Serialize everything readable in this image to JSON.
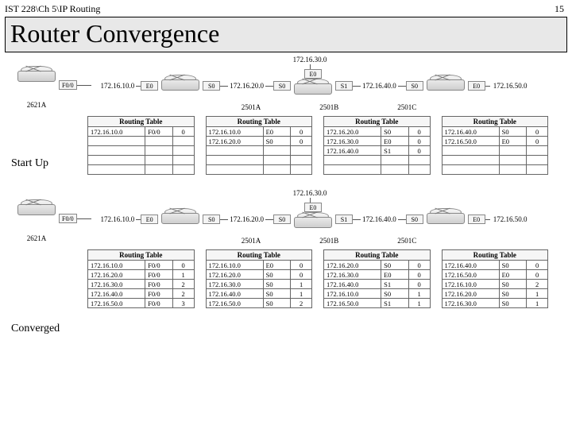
{
  "header": {
    "course": "IST 228\\Ch 5\\IP Routing",
    "page": "15"
  },
  "title": "Router Convergence",
  "labels": {
    "startup": "Start Up",
    "converged": "Converged",
    "rt_title": "Routing Table"
  },
  "nets": {
    "n10": "172.16.10.0",
    "n20": "172.16.20.0",
    "n30": "172.16.30.0",
    "n40": "172.16.40.0",
    "n50": "172.16.50.0"
  },
  "ports": {
    "f00": "F0/0",
    "e0": "E0",
    "s0": "S0",
    "s1": "S1"
  },
  "routers": {
    "a": "2621A",
    "b": "2501A",
    "c": "2501B",
    "d": "2501C"
  },
  "startup": {
    "r2621A": [
      [
        "172.16.10.0",
        "F0/0",
        "0"
      ]
    ],
    "r2501A": [
      [
        "172.16.10.0",
        "E0",
        "0"
      ],
      [
        "172.16.20.0",
        "S0",
        "0"
      ]
    ],
    "r2501B": [
      [
        "172.16.20.0",
        "S0",
        "0"
      ],
      [
        "172.16.30.0",
        "E0",
        "0"
      ],
      [
        "172.16.40.0",
        "S1",
        "0"
      ]
    ],
    "r2501C": [
      [
        "172.16.40.0",
        "S0",
        "0"
      ],
      [
        "172.16.50.0",
        "E0",
        "0"
      ]
    ]
  },
  "converged": {
    "r2621A": [
      [
        "172.16.10.0",
        "F0/0",
        "0"
      ],
      [
        "172.16.20.0",
        "F0/0",
        "1"
      ],
      [
        "172.16.30.0",
        "F0/0",
        "2"
      ],
      [
        "172.16.40.0",
        "F0/0",
        "2"
      ],
      [
        "172.16.50.0",
        "F0/0",
        "3"
      ]
    ],
    "r2501A": [
      [
        "172.16.10.0",
        "E0",
        "0"
      ],
      [
        "172.16.20.0",
        "S0",
        "0"
      ],
      [
        "172.16.30.0",
        "S0",
        "1"
      ],
      [
        "172.16.40.0",
        "S0",
        "1"
      ],
      [
        "172.16.50.0",
        "S0",
        "2"
      ]
    ],
    "r2501B": [
      [
        "172.16.20.0",
        "S0",
        "0"
      ],
      [
        "172.16.30.0",
        "E0",
        "0"
      ],
      [
        "172.16.40.0",
        "S1",
        "0"
      ],
      [
        "172.16.10.0",
        "S0",
        "1"
      ],
      [
        "172.16.50.0",
        "S1",
        "1"
      ]
    ],
    "r2501C": [
      [
        "172.16.40.0",
        "S0",
        "0"
      ],
      [
        "172.16.50.0",
        "E0",
        "0"
      ],
      [
        "172.16.10.0",
        "S0",
        "2"
      ],
      [
        "172.16.20.0",
        "S0",
        "1"
      ],
      [
        "172.16.30.0",
        "S0",
        "1"
      ]
    ]
  }
}
